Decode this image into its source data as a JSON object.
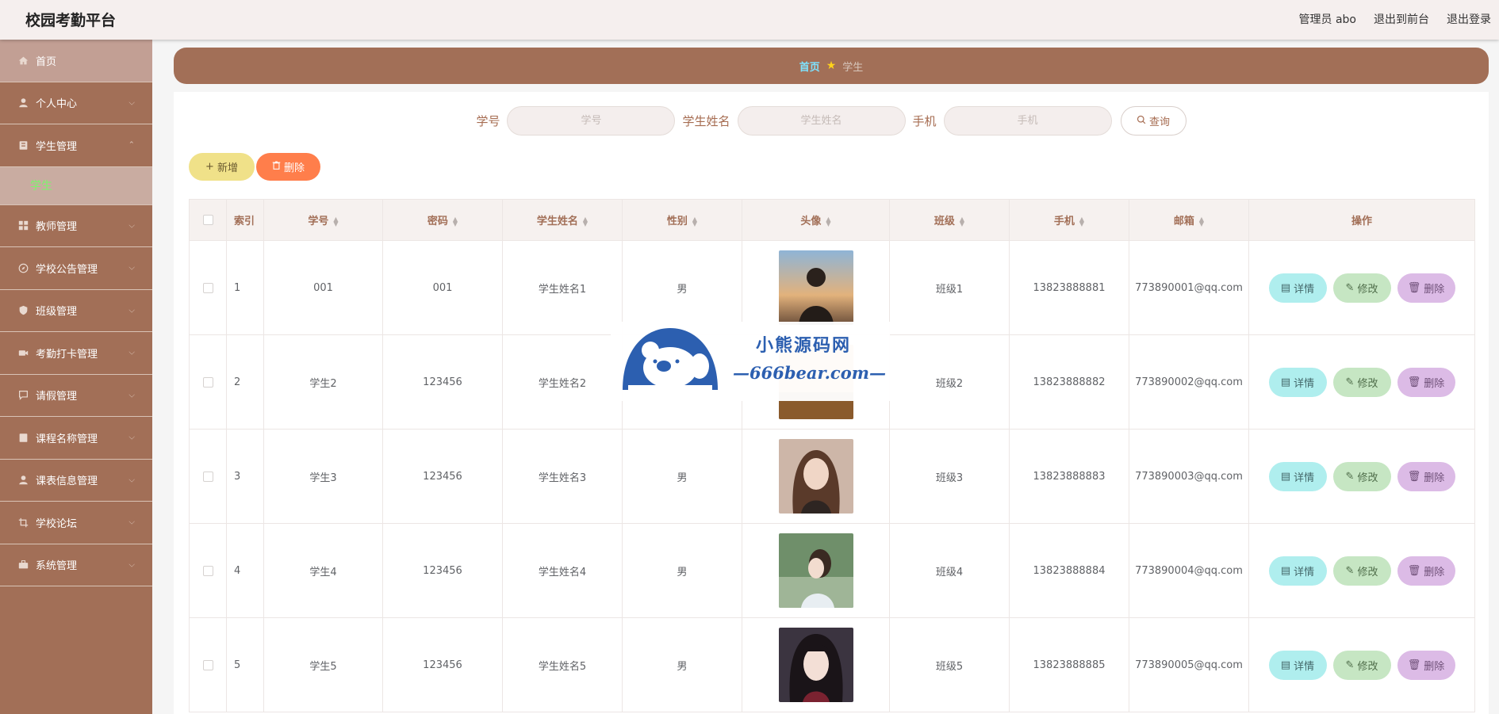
{
  "header": {
    "app_title": "校园考勤平台",
    "admin_label": "管理员 abo",
    "to_front_label": "退出到前台",
    "logout_label": "退出登录"
  },
  "sidebar": {
    "items": [
      {
        "label": "首页",
        "icon": "home-icon"
      },
      {
        "label": "个人中心",
        "icon": "user-icon"
      },
      {
        "label": "学生管理",
        "icon": "id-card-icon",
        "children": [
          {
            "label": "学生"
          }
        ]
      },
      {
        "label": "教师管理",
        "icon": "grid-icon"
      },
      {
        "label": "学校公告管理",
        "icon": "compass-icon"
      },
      {
        "label": "班级管理",
        "icon": "shield-icon"
      },
      {
        "label": "考勤打卡管理",
        "icon": "camera-icon"
      },
      {
        "label": "请假管理",
        "icon": "chat-icon"
      },
      {
        "label": "课程名称管理",
        "icon": "document-icon"
      },
      {
        "label": "课表信息管理",
        "icon": "user-icon"
      },
      {
        "label": "学校论坛",
        "icon": "crop-icon"
      },
      {
        "label": "系统管理",
        "icon": "toolbox-icon"
      }
    ]
  },
  "breadcrumb": {
    "home": "首页",
    "current": "学生"
  },
  "search": {
    "fields": [
      {
        "label": "学号",
        "placeholder": "学号"
      },
      {
        "label": "学生姓名",
        "placeholder": "学生姓名"
      },
      {
        "label": "手机",
        "placeholder": "手机"
      }
    ],
    "query_label": "查询"
  },
  "actions": {
    "add_label": "新增",
    "delete_label": "删除"
  },
  "table": {
    "columns": [
      "索引",
      "学号",
      "密码",
      "学生姓名",
      "性别",
      "头像",
      "班级",
      "手机",
      "邮箱",
      "操作"
    ],
    "rows": [
      {
        "index": "1",
        "student_no": "001",
        "password": "001",
        "name": "学生姓名1",
        "gender": "男",
        "class": "班级1",
        "phone": "13823888881",
        "email": "773890001@qq.com"
      },
      {
        "index": "2",
        "student_no": "学生2",
        "password": "123456",
        "name": "学生姓名2",
        "gender": "",
        "class": "班级2",
        "phone": "13823888882",
        "email": "773890002@qq.com"
      },
      {
        "index": "3",
        "student_no": "学生3",
        "password": "123456",
        "name": "学生姓名3",
        "gender": "男",
        "class": "班级3",
        "phone": "13823888883",
        "email": "773890003@qq.com"
      },
      {
        "index": "4",
        "student_no": "学生4",
        "password": "123456",
        "name": "学生姓名4",
        "gender": "男",
        "class": "班级4",
        "phone": "13823888884",
        "email": "773890004@qq.com"
      },
      {
        "index": "5",
        "student_no": "学生5",
        "password": "123456",
        "name": "学生姓名5",
        "gender": "男",
        "class": "班级5",
        "phone": "13823888885",
        "email": "773890005@qq.com"
      }
    ],
    "row_actions": {
      "detail": "详情",
      "edit": "修改",
      "delete": "删除"
    }
  },
  "watermark": {
    "title": "小熊源码网",
    "url": "—666bear.com—"
  }
}
